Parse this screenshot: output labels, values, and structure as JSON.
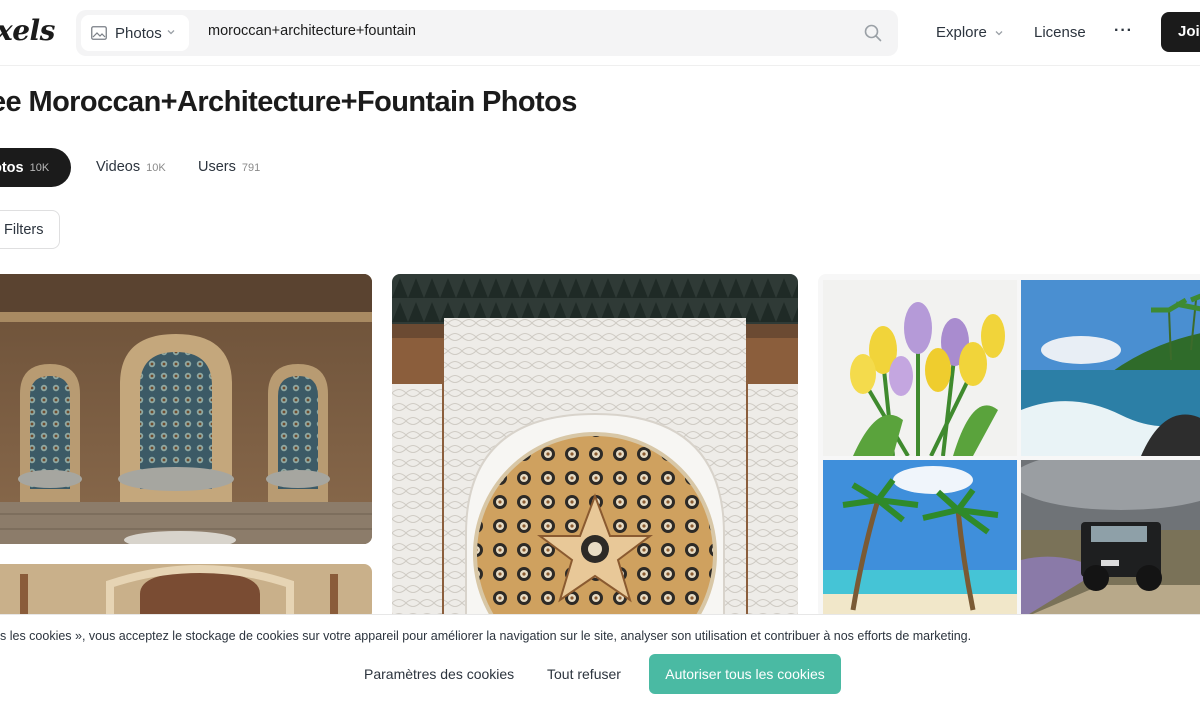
{
  "header": {
    "logo_text": "xels",
    "search": {
      "type_label": "Photos",
      "value": "moroccan+architecture+fountain",
      "type_icon": "image-icon",
      "submit_icon": "search-icon"
    },
    "nav": {
      "explore_label": "Explore",
      "license_label": "License",
      "more_label": "···",
      "join_label": "Join"
    }
  },
  "page": {
    "title": "ee Moroccan+Architecture+Fountain Photos"
  },
  "tabs": [
    {
      "label": "otos",
      "count": "10K",
      "active": true
    },
    {
      "label": "Videos",
      "count": "10K",
      "active": false
    },
    {
      "label": "Users",
      "count": "791",
      "active": false
    }
  ],
  "filters": {
    "label": "Filters"
  },
  "cookie": {
    "text": "s les cookies », vous acceptez le stockage de cookies sur votre appareil pour améliorer la navigation sur le site, analyser son utilisation et contribuer à nos efforts de marketing.",
    "params_label": "Paramètres des cookies",
    "refuse_label": "Tout refuser",
    "accept_label": "Autoriser tous les cookies"
  },
  "colors": {
    "accent_green": "#05a081",
    "dark": "#1b1b1b",
    "search_bg": "#f4f4f5"
  }
}
